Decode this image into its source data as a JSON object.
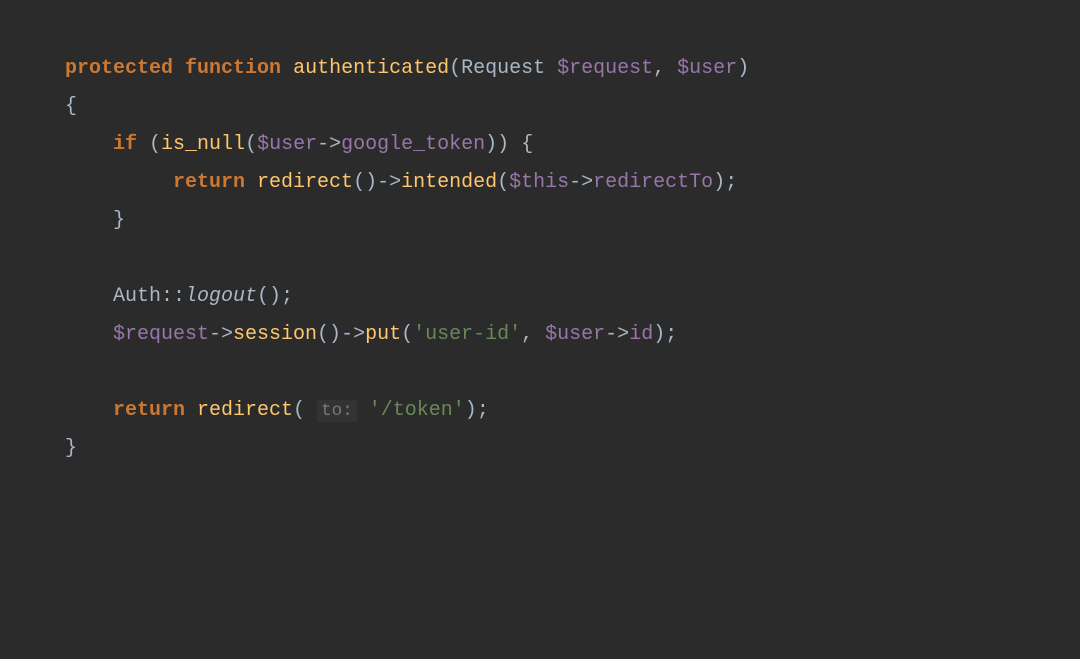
{
  "code": {
    "line1": {
      "protected": "protected",
      "function": "function",
      "fname": "authenticated",
      "lparen": "(",
      "type1": "Request ",
      "var1": "$request",
      "comma": ", ",
      "var2": "$user",
      "rparen": ")"
    },
    "line2": "{",
    "line3": {
      "if": "if",
      "sp": " ",
      "lparen": "(",
      "isnull": "is_null",
      "lparen2": "(",
      "var": "$user",
      "arrow": "->",
      "prop": "google_token",
      "rparen": ")",
      "rparen2": ")",
      "sp2": " ",
      "brace": "{"
    },
    "line4": {
      "return": "return",
      "sp": " ",
      "redirect": "redirect",
      "parens": "()",
      "arrow": "->",
      "intended": "intended",
      "lparen": "(",
      "this": "$this",
      "arrow2": "->",
      "redirectTo": "redirectTo",
      "rparen": ")",
      "semi": ";"
    },
    "line5": "}",
    "line6": {
      "class": "Auth",
      "dcolon": "::",
      "logout": "logout",
      "parens": "()",
      "semi": ";"
    },
    "line7": {
      "var": "$request",
      "arrow": "->",
      "session": "session",
      "parens": "()",
      "arrow2": "->",
      "put": "put",
      "lparen": "(",
      "str": "'user-id'",
      "comma": ", ",
      "user": "$user",
      "arrow3": "->",
      "id": "id",
      "rparen": ")",
      "semi": ";"
    },
    "line8": {
      "return": "return",
      "sp": " ",
      "redirect": "redirect",
      "lparen": "(",
      "sp2": " ",
      "hint": "to:",
      "sp3": " ",
      "str": "'/token'",
      "rparen": ")",
      "semi": ";"
    },
    "line9": "}"
  }
}
